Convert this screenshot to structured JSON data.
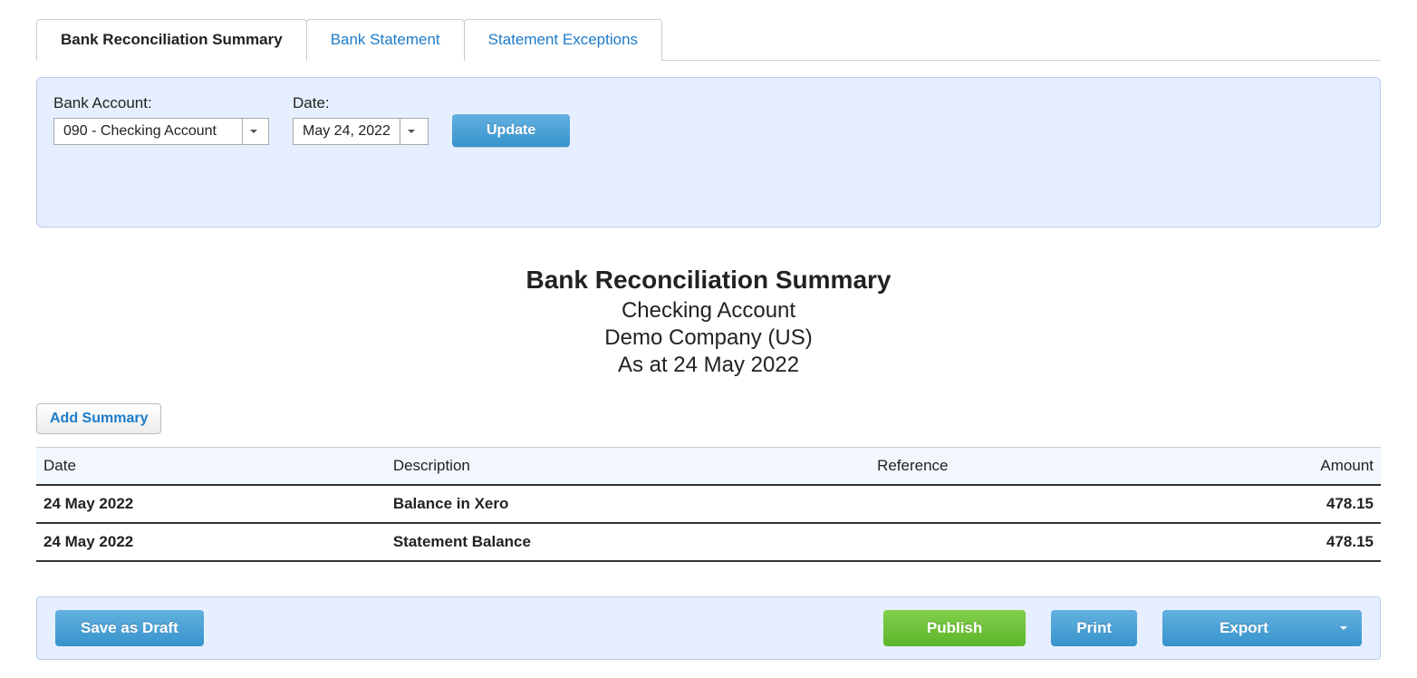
{
  "tabs": [
    {
      "label": "Bank Reconciliation Summary",
      "active": true
    },
    {
      "label": "Bank Statement",
      "active": false
    },
    {
      "label": "Statement Exceptions",
      "active": false
    }
  ],
  "filters": {
    "bank_account_label": "Bank Account:",
    "bank_account_value": "090 - Checking Account",
    "date_label": "Date:",
    "date_value": "May 24, 2022",
    "update_button": "Update"
  },
  "report": {
    "title": "Bank Reconciliation Summary",
    "account_name": "Checking Account",
    "company": "Demo Company (US)",
    "as_at": "As at 24 May 2022"
  },
  "add_summary_button": "Add Summary",
  "table": {
    "headers": {
      "date": "Date",
      "description": "Description",
      "reference": "Reference",
      "amount": "Amount"
    },
    "rows": [
      {
        "date": "24 May 2022",
        "description": "Balance in Xero",
        "reference": "",
        "amount": "478.15"
      },
      {
        "date": "24 May 2022",
        "description": "Statement Balance",
        "reference": "",
        "amount": "478.15"
      }
    ]
  },
  "footer": {
    "save_draft": "Save as Draft",
    "publish": "Publish",
    "print": "Print",
    "export": "Export"
  }
}
